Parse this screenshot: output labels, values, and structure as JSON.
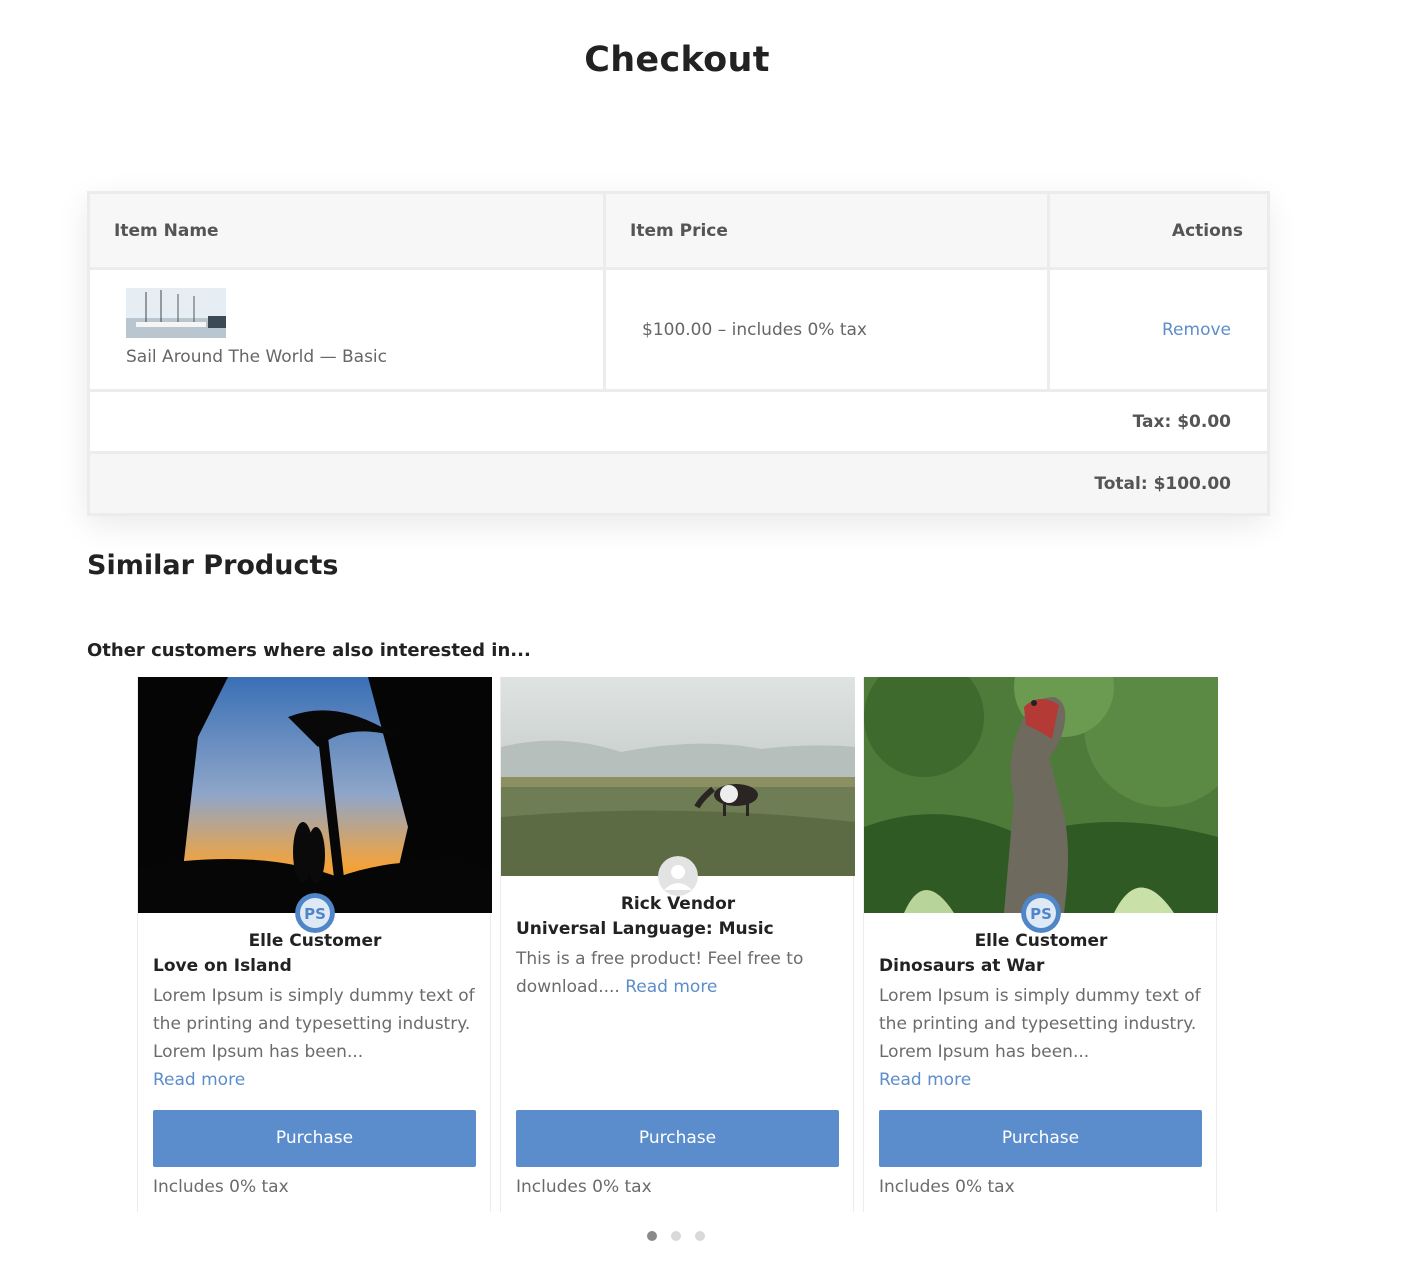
{
  "page": {
    "title": "Checkout"
  },
  "cart": {
    "columns": {
      "item_name": "Item Name",
      "item_price": "Item Price",
      "actions": "Actions"
    },
    "items": [
      {
        "name": "Sail Around The World — Basic",
        "price": "$100.00 – includes 0% tax",
        "action": "Remove"
      }
    ],
    "tax": "Tax: $0.00",
    "total": "Total: $100.00"
  },
  "similar": {
    "title": "Similar Products",
    "subtitle": "Other customers where also interested in...",
    "products": [
      {
        "vendor": "Elle Customer",
        "title": "Love on Island",
        "description": "Lorem Ipsum is simply dummy text of the printing and typesetting industry. Lorem Ipsum has been...",
        "read_more": "Read more",
        "button": "Purchase",
        "tax_note": "Includes 0% tax"
      },
      {
        "vendor": "Rick Vendor",
        "title": "Universal Language: Music",
        "description": "This is a free product! Feel free to download....",
        "read_more": "Read more",
        "button": "Purchase",
        "tax_note": "Includes 0% tax"
      },
      {
        "vendor": "Elle Customer",
        "title": "Dinosaurs at War",
        "description": "Lorem Ipsum is simply dummy text of the printing and typesetting industry. Lorem Ipsum has been...",
        "read_more": "Read more",
        "button": "Purchase",
        "tax_note": "Includes 0% tax"
      }
    ],
    "carousel": {
      "pages": 3,
      "active": 1
    }
  },
  "colors": {
    "accent": "#5b8dcc",
    "heading": "#222222",
    "text": "#666666"
  }
}
